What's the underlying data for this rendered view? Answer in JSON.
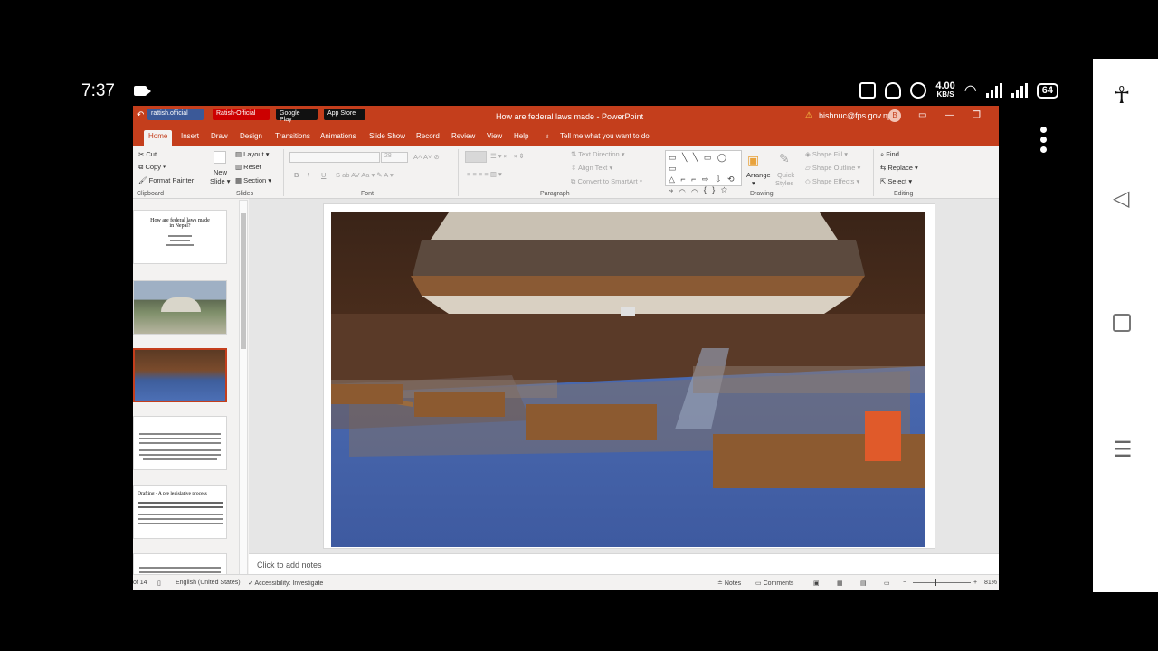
{
  "phone_status": {
    "time": "7:37",
    "net_speed_value": "4.00",
    "net_speed_unit": "KB/S",
    "battery": "64"
  },
  "titlebar": {
    "badges": [
      "rattish.official",
      "Ratish-Official",
      "Google Play",
      "App Store"
    ],
    "document_title": "How are federal laws made  -  PowerPoint",
    "user_email": "bishnuc@fps.gov.np",
    "avatar_initial": "B",
    "colors": {
      "accent": "#c43e1c"
    }
  },
  "tabs": [
    "Home",
    "Insert",
    "Draw",
    "Design",
    "Transitions",
    "Animations",
    "Slide Show",
    "Record",
    "Review",
    "View",
    "Help"
  ],
  "tell_me": "Tell me what you want to do",
  "ribbon": {
    "clipboard": {
      "cut": "Cut",
      "copy": "Copy",
      "format_painter": "Format Painter",
      "label": "Clipboard"
    },
    "slides": {
      "new_slide": "New",
      "new_slide_2": "Slide",
      "layout": "Layout",
      "reset": "Reset",
      "section": "Section",
      "label": "Slides"
    },
    "font": {
      "label": "Font",
      "size": "28"
    },
    "paragraph": {
      "text_direction": "Text Direction",
      "align_text": "Align Text",
      "smartart": "Convert to SmartArt",
      "label": "Paragraph"
    },
    "drawing": {
      "arrange": "Arrange",
      "quick_styles": "Quick",
      "quick_styles_2": "Styles",
      "shape_fill": "Shape Fill",
      "shape_outline": "Shape Outline",
      "shape_effects": "Shape Effects",
      "label": "Drawing"
    },
    "editing": {
      "find": "Find",
      "replace": "Replace",
      "select": "Select",
      "label": "Editing"
    }
  },
  "thumbnails": {
    "slide1_title": "How are federal laws made in Nepal?",
    "slide5_title": "Drafting - A pre legislative process"
  },
  "notes": {
    "placeholder": "Click to add notes"
  },
  "statusbar": {
    "slide_count": "of 14",
    "language": "English (United States)",
    "accessibility": "Accessibility: Investigate",
    "notes": "Notes",
    "comments": "Comments",
    "zoom": "81%"
  }
}
